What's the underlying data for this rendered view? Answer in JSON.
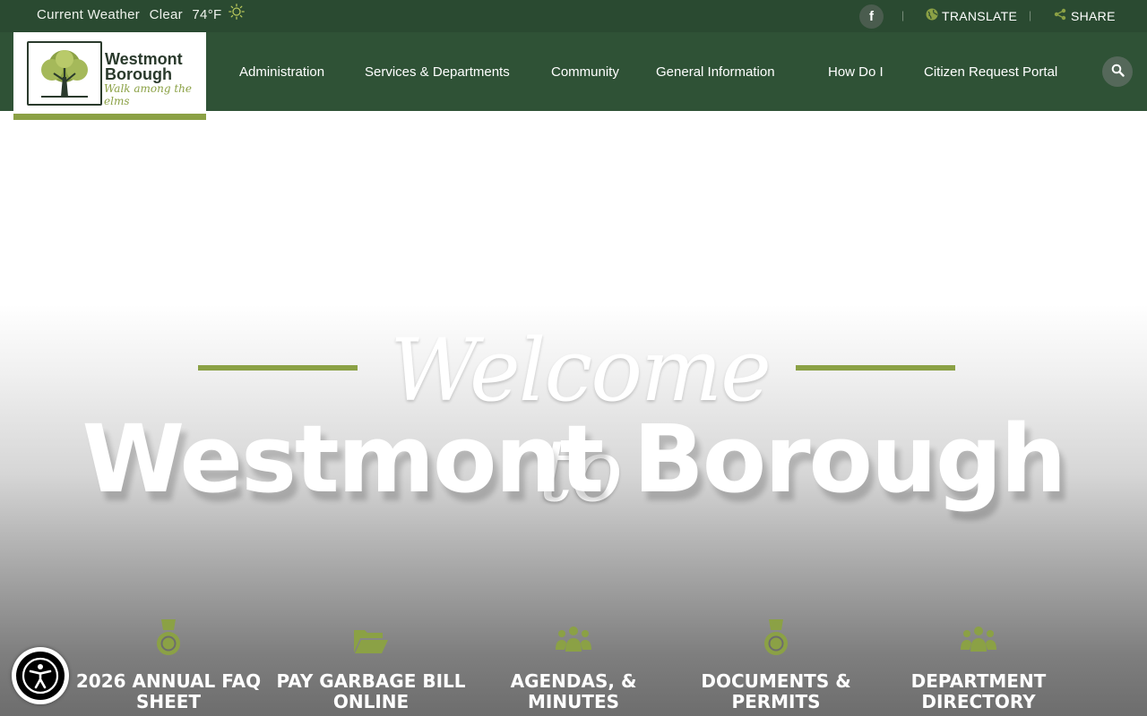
{
  "topbar": {
    "weather_label": "Current Weather",
    "weather_condition": "Clear",
    "weather_temp": "74°F",
    "weather_icon": "sun-icon",
    "social_icon": "facebook-icon",
    "separator": "|",
    "translate_label": "TRANSLATE",
    "share_label": "SHARE"
  },
  "logo": {
    "title_line1": "Westmont",
    "title_line2": "Borough",
    "tagline": "Walk among the elms"
  },
  "nav": {
    "items": [
      {
        "label": "Administration"
      },
      {
        "label": "Services & Departments"
      },
      {
        "label": "Community"
      },
      {
        "label": "General Information"
      },
      {
        "label": "How Do I"
      },
      {
        "label": "Citizen Request Portal"
      }
    ],
    "search_icon": "search-icon"
  },
  "hero": {
    "welcome": "Welcome to",
    "title": "Westmont Borough"
  },
  "quick_links": [
    {
      "label": "2026 ANNUAL FAQ SHEET",
      "icon": "medal-icon"
    },
    {
      "label": "PAY GARBAGE BILL ONLINE",
      "icon": "folder-open-icon"
    },
    {
      "label": "AGENDAS, & MINUTES",
      "icon": "people-group-icon"
    },
    {
      "label": "DOCUMENTS & PERMITS",
      "icon": "medal-icon"
    },
    {
      "label": "DEPARTMENT DIRECTORY",
      "icon": "people-group-icon"
    }
  ],
  "colors": {
    "topbar_bg": "#2a4a31",
    "nav_bg": "#2f5236",
    "accent_green": "#8ba145"
  }
}
